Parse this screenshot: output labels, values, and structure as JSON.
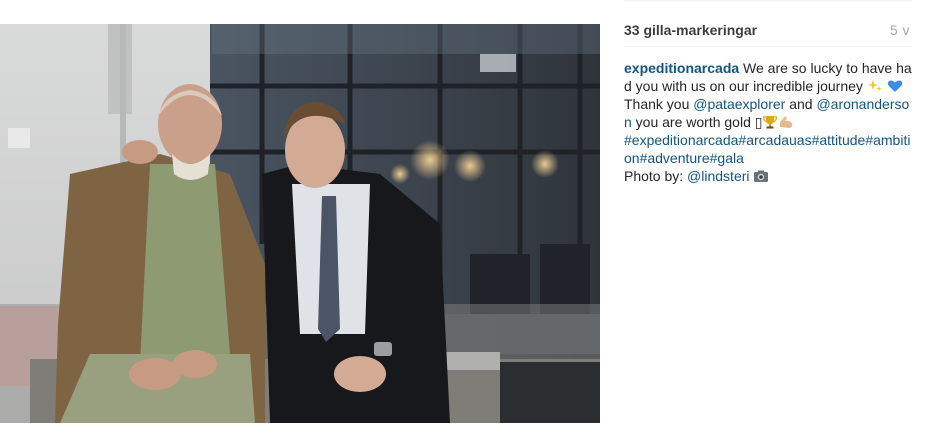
{
  "post": {
    "likes": "33 gilla-markeringar",
    "age": "5 v",
    "username": "expeditionarcada",
    "caption_part1": "We are so lucky to have had you with us on our incredible journey ",
    "caption_part2": " Thank you ",
    "mention1": "@pataexplorer",
    "caption_part3": " and ",
    "mention2": "@aronanderson",
    "caption_part4": " you are worth gold ",
    "missing_glyph": "▯",
    "hashtags": [
      "#expeditionarcada",
      "#arcadauas",
      "#attitude",
      "#ambition",
      "#adventure",
      "#gala"
    ],
    "photo_by_label": "Photo by: ",
    "mention3": "@lindsteri"
  },
  "icons": {
    "sparkles": "sparkles-icon",
    "blue_heart": "blue-heart-icon",
    "trophy": "trophy-icon",
    "flexed_biceps": "flexed-biceps-icon",
    "camera": "camera-icon"
  },
  "colors": {
    "link": "#125688",
    "text": "#262626",
    "muted": "#a5a7aa"
  }
}
